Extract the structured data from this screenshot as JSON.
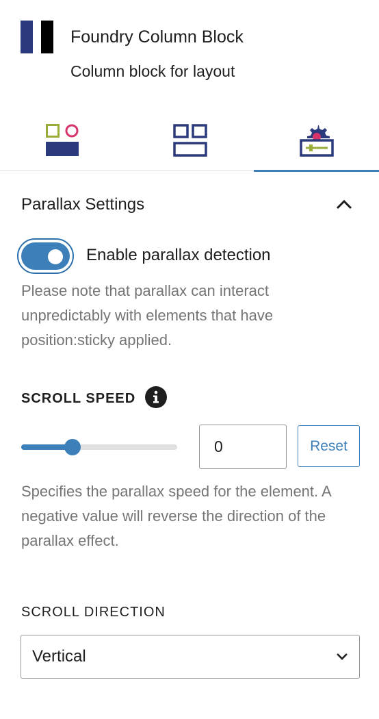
{
  "block": {
    "title": "Foundry Column Block",
    "description": "Column block for layout",
    "icon": "column-block-icon"
  },
  "tabs": [
    {
      "icon": "styles-tab-icon",
      "active": false
    },
    {
      "icon": "layout-tab-icon",
      "active": false
    },
    {
      "icon": "advanced-settings-tab-icon",
      "active": true
    }
  ],
  "panel": {
    "title": "Parallax Settings",
    "expanded": true,
    "toggle": {
      "label": "Enable parallax detection",
      "checked": true,
      "help": "Please note that parallax can interact unpredictably with elements that have position:sticky applied."
    },
    "scroll_speed": {
      "label": "SCROLL SPEED",
      "slider_level": 0.33,
      "value": "0",
      "reset_label": "Reset",
      "help": "Specifies the parallax speed for the element. A negative value will reverse the direction of the parallax effect."
    },
    "scroll_direction": {
      "label": "SCROLL DIRECTION",
      "value": "Vertical"
    }
  },
  "colors": {
    "accent": "#3d80b9",
    "icon_navy": "#2b3a7d",
    "icon_olive": "#9aab3a",
    "icon_pink": "#d8336a",
    "help_text": "#757575"
  }
}
